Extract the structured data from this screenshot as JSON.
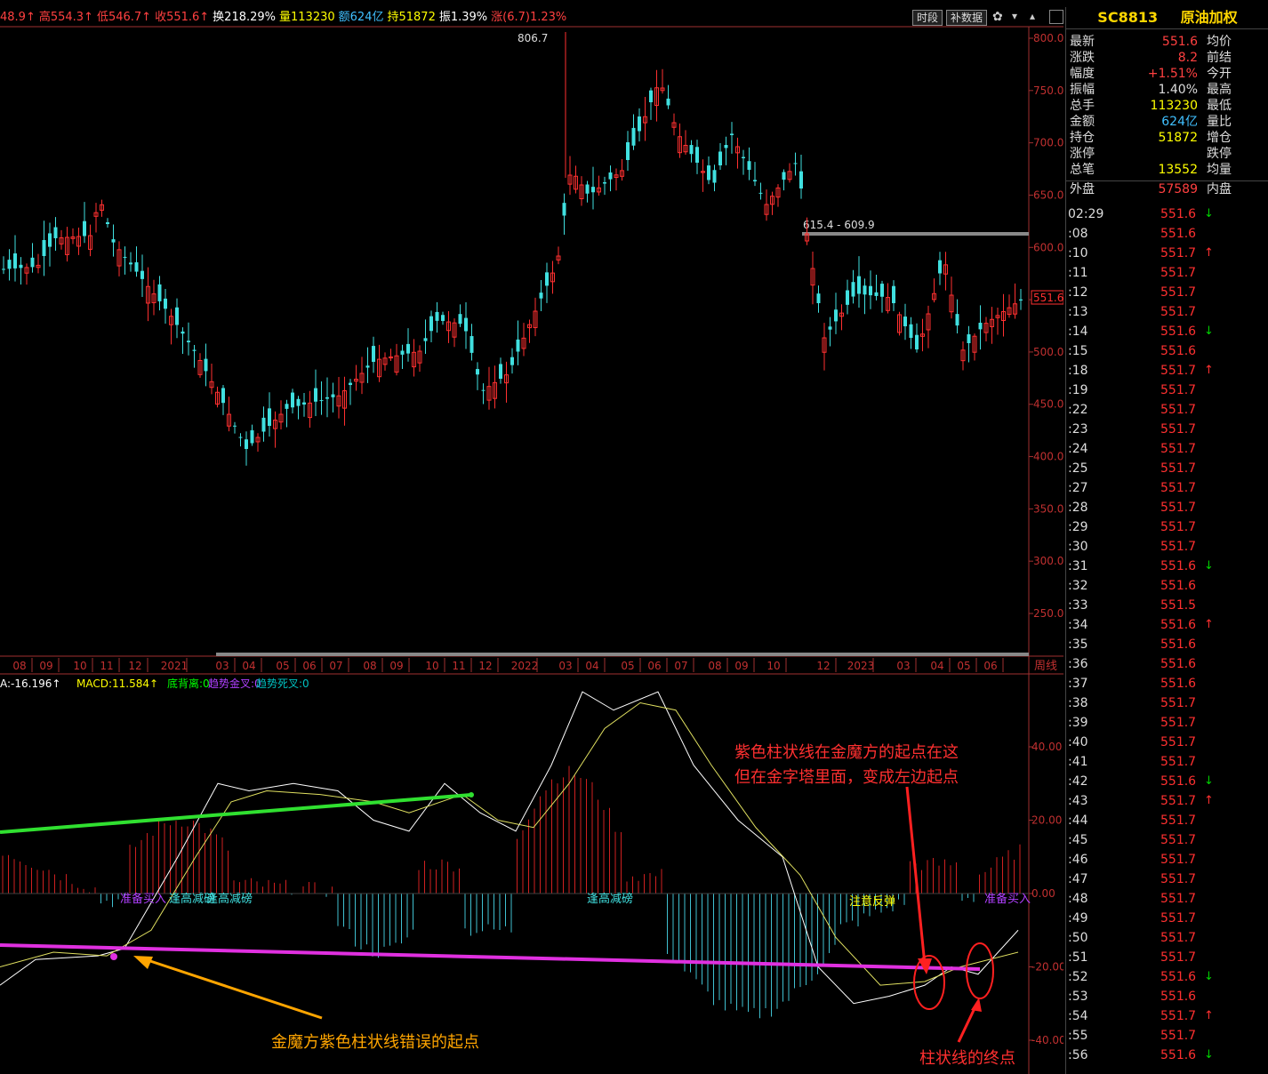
{
  "topbar": {
    "items": [
      {
        "text": "48.9↑",
        "color": "#ff4040"
      },
      {
        "text": "高554.3↑",
        "color": "#ff4040"
      },
      {
        "text": "低546.7↑",
        "color": "#ff4040"
      },
      {
        "text": "收551.6↑",
        "color": "#ff4040"
      },
      {
        "text": "换218.29%",
        "color": "#ffffff"
      },
      {
        "text": "量113230",
        "color": "#ffff00"
      },
      {
        "text": "额624亿",
        "color": "#40c0ff"
      },
      {
        "text": "持51872",
        "color": "#ffff00"
      },
      {
        "text": "振1.39%",
        "color": "#ffffff"
      },
      {
        "text": "涨(6.7)1.23%",
        "color": "#ff4040"
      }
    ],
    "btn_period": "时段",
    "btn_fill": "补数据"
  },
  "panel": {
    "code": "SC8813",
    "name": "原油加权",
    "quotes": [
      {
        "l1": "最新",
        "v1": "551.6",
        "c1": "#ff4040",
        "l2": "均价"
      },
      {
        "l1": "涨跌",
        "v1": "8.2",
        "c1": "#ff4040",
        "l2": "前结"
      },
      {
        "l1": "幅度",
        "v1": "+1.51%",
        "c1": "#ff4040",
        "l2": "今开"
      },
      {
        "l1": "振幅",
        "v1": "1.40%",
        "c1": "#dddddd",
        "l2": "最高"
      },
      {
        "l1": "总手",
        "v1": "113230",
        "c1": "#ffff00",
        "l2": "最低"
      },
      {
        "l1": "金额",
        "v1": "624亿",
        "c1": "#40c0ff",
        "l2": "量比"
      },
      {
        "l1": "持仓",
        "v1": "51872",
        "c1": "#ffff00",
        "l2": "增仓"
      },
      {
        "l1": "涨停",
        "v1": "",
        "c1": "#dddddd",
        "l2": "跌停"
      },
      {
        "l1": "总笔",
        "v1": "13552",
        "c1": "#ffff00",
        "l2": "均量"
      },
      {
        "l1": "外盘",
        "v1": "57589",
        "c1": "#ff4040",
        "l2": "内盘"
      }
    ],
    "ticks": [
      {
        "t": "02:29",
        "p": "551.6",
        "a": "↓"
      },
      {
        "t": ":08",
        "p": "551.6",
        "a": ""
      },
      {
        "t": ":10",
        "p": "551.7",
        "a": "↑"
      },
      {
        "t": ":11",
        "p": "551.7",
        "a": ""
      },
      {
        "t": ":12",
        "p": "551.7",
        "a": ""
      },
      {
        "t": ":13",
        "p": "551.7",
        "a": ""
      },
      {
        "t": ":14",
        "p": "551.6",
        "a": "↓"
      },
      {
        "t": ":15",
        "p": "551.6",
        "a": ""
      },
      {
        "t": ":18",
        "p": "551.7",
        "a": "↑"
      },
      {
        "t": ":19",
        "p": "551.7",
        "a": ""
      },
      {
        "t": ":22",
        "p": "551.7",
        "a": ""
      },
      {
        "t": ":23",
        "p": "551.7",
        "a": ""
      },
      {
        "t": ":24",
        "p": "551.7",
        "a": ""
      },
      {
        "t": ":25",
        "p": "551.7",
        "a": ""
      },
      {
        "t": ":27",
        "p": "551.7",
        "a": ""
      },
      {
        "t": ":28",
        "p": "551.7",
        "a": ""
      },
      {
        "t": ":29",
        "p": "551.7",
        "a": ""
      },
      {
        "t": ":30",
        "p": "551.7",
        "a": ""
      },
      {
        "t": ":31",
        "p": "551.6",
        "a": "↓"
      },
      {
        "t": ":32",
        "p": "551.6",
        "a": ""
      },
      {
        "t": ":33",
        "p": "551.5",
        "a": ""
      },
      {
        "t": ":34",
        "p": "551.6",
        "a": "↑"
      },
      {
        "t": ":35",
        "p": "551.6",
        "a": ""
      },
      {
        "t": ":36",
        "p": "551.6",
        "a": ""
      },
      {
        "t": ":37",
        "p": "551.6",
        "a": ""
      },
      {
        "t": ":38",
        "p": "551.7",
        "a": ""
      },
      {
        "t": ":39",
        "p": "551.7",
        "a": ""
      },
      {
        "t": ":40",
        "p": "551.7",
        "a": ""
      },
      {
        "t": ":41",
        "p": "551.7",
        "a": ""
      },
      {
        "t": ":42",
        "p": "551.6",
        "a": "↓"
      },
      {
        "t": ":43",
        "p": "551.7",
        "a": "↑"
      },
      {
        "t": ":44",
        "p": "551.7",
        "a": ""
      },
      {
        "t": ":45",
        "p": "551.7",
        "a": ""
      },
      {
        "t": ":46",
        "p": "551.7",
        "a": ""
      },
      {
        "t": ":47",
        "p": "551.7",
        "a": ""
      },
      {
        "t": ":48",
        "p": "551.7",
        "a": ""
      },
      {
        "t": ":49",
        "p": "551.7",
        "a": ""
      },
      {
        "t": ":50",
        "p": "551.7",
        "a": ""
      },
      {
        "t": ":51",
        "p": "551.7",
        "a": ""
      },
      {
        "t": ":52",
        "p": "551.6",
        "a": "↓"
      },
      {
        "t": ":53",
        "p": "551.6",
        "a": ""
      },
      {
        "t": ":54",
        "p": "551.7",
        "a": "↑"
      },
      {
        "t": ":55",
        "p": "551.7",
        "a": ""
      },
      {
        "t": ":56",
        "p": "551.6",
        "a": "↓"
      }
    ]
  },
  "price_axis": [
    "800.0",
    "750.0",
    "700.0",
    "650.0",
    "600.0",
    "550.0",
    "500.0",
    "450.0",
    "400.0",
    "350.0",
    "300.0",
    "250.0"
  ],
  "macd_axis": [
    "40.00",
    "20.00",
    "0.00",
    "-20.00",
    "-40.00"
  ],
  "time_axis": [
    "08",
    "09",
    "10",
    "11",
    "12",
    "2021",
    "03",
    "04",
    "05",
    "06",
    "07",
    "08",
    "09",
    "10",
    "11",
    "12",
    "2022",
    "03",
    "04",
    "05",
    "06",
    "07",
    "08",
    "09",
    "10",
    "12",
    "2023",
    "03",
    "04",
    "05",
    "06"
  ],
  "period_label": "周线",
  "peak_label": "806.7",
  "range_label": "615.4 - 609.9",
  "current_price": "551.6",
  "macd_header": [
    {
      "text": "A:-16.196↑",
      "color": "#ffffff"
    },
    {
      "text": "MACD:11.584↑",
      "color": "#ffff00"
    },
    {
      "text": "底背离:0",
      "color": "#00ff00"
    },
    {
      "text": "趋势金叉:0",
      "color": "#b040ff"
    },
    {
      "text": "趋势死叉:0",
      "color": "#00c0c0"
    }
  ],
  "signals": {
    "s1": "准备买入",
    "s2": "逢高减磅",
    "s3": "逢高减磅",
    "s4": "逢高减磅",
    "s5": "注意反弹",
    "s6": "准备买入"
  },
  "annotations": {
    "top_red_1": "紫色柱状线在金魔方的起点在这",
    "top_red_2": "但在金字塔里面，变成左边起点",
    "orange": "金魔方紫色柱状线错误的起点",
    "end": "柱状线的终点"
  },
  "chart_data": {
    "type": "candlestick",
    "title": "SC8813 原油加权",
    "xlabel": "周线",
    "ylim": [
      210,
      820
    ],
    "peak": 806.7,
    "last": 551.6,
    "macd_ylim": [
      -42,
      57
    ]
  }
}
